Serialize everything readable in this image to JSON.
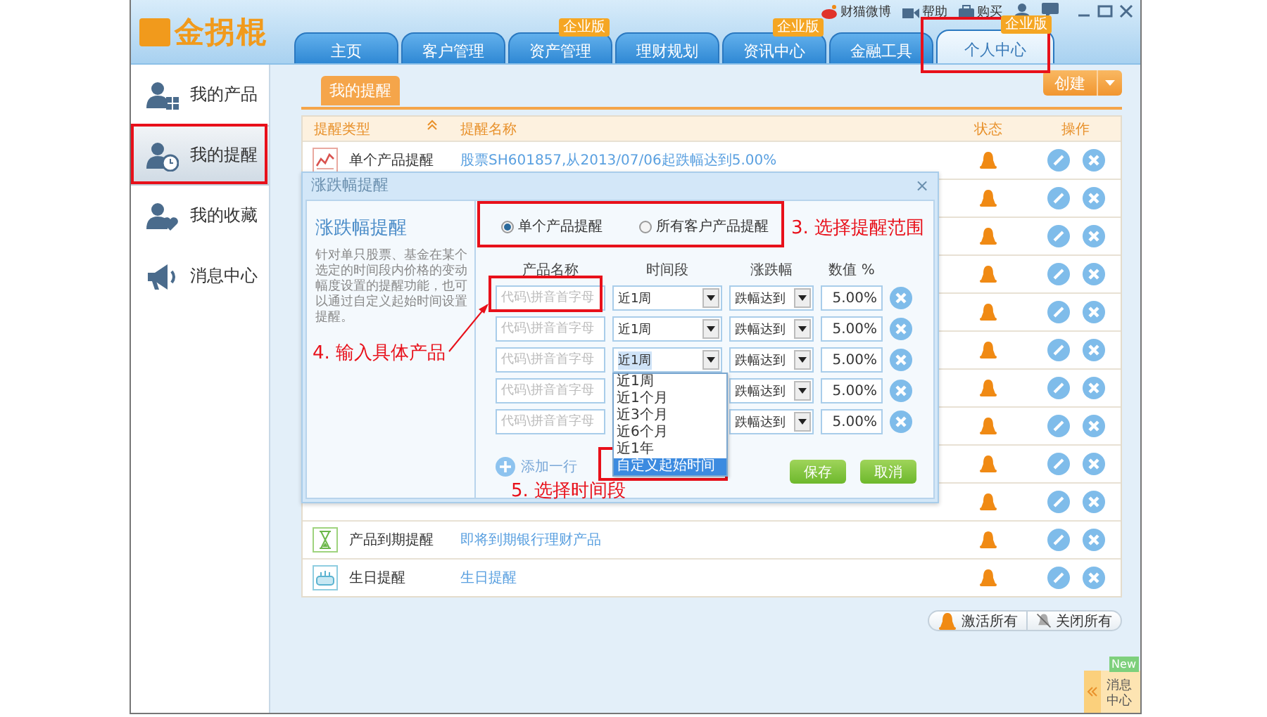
{
  "header": {
    "logo": "金拐棍",
    "top_links": [
      {
        "kind": "weibo",
        "label": "财猫微博"
      },
      {
        "kind": "video",
        "label": "帮助"
      },
      {
        "kind": "bag",
        "label": "购买"
      }
    ]
  },
  "tabs": [
    {
      "label": "主页",
      "selected": false
    },
    {
      "label": "客户管理",
      "selected": false
    },
    {
      "label": "资产管理",
      "badge": "企业版",
      "selected": false
    },
    {
      "label": "理财规划",
      "selected": false
    },
    {
      "label": "资讯中心",
      "badge": "企业版",
      "selected": false
    },
    {
      "label": "金融工具",
      "selected": false
    },
    {
      "label": "个人中心",
      "badge": "企业版",
      "selected": true
    }
  ],
  "sidebar": {
    "items": [
      {
        "kind": "products",
        "label": "我的产品",
        "selected": false
      },
      {
        "kind": "reminders",
        "label": "我的提醒",
        "selected": true
      },
      {
        "kind": "favorites",
        "label": "我的收藏",
        "selected": false
      },
      {
        "kind": "messages",
        "label": "消息中心",
        "selected": false
      }
    ]
  },
  "subtab": "我的提醒",
  "create_button": "创建",
  "table": {
    "columns": [
      "提醒类型",
      "提醒名称",
      "状态",
      "操作"
    ],
    "rows": [
      {
        "kind": "price",
        "type": "单个产品提醒",
        "name": "股票SH601857,从2013/07/06起跌幅达到5.00%"
      },
      {
        "kind": "covered"
      },
      {
        "kind": "covered"
      },
      {
        "kind": "covered"
      },
      {
        "kind": "covered"
      },
      {
        "kind": "covered"
      },
      {
        "kind": "covered"
      },
      {
        "kind": "covered"
      },
      {
        "kind": "covered"
      },
      {
        "kind": "covered"
      },
      {
        "kind": "expiry",
        "type": "产品到期提醒",
        "name": "即将到期银行理财产品"
      },
      {
        "kind": "birthday",
        "type": "生日提醒",
        "name": "生日提醒"
      }
    ]
  },
  "dialog": {
    "title": "涨跌幅提醒",
    "close": "×",
    "heading": "涨跌幅提醒",
    "description": "针对单只股票、基金在某个选定的时间段内价格的变动幅度设置的提醒功能，也可以通过自定义起始时间设置提醒。",
    "scope": [
      {
        "label": "单个产品提醒",
        "selected": true
      },
      {
        "label": "所有客户产品提醒",
        "selected": false
      }
    ],
    "columns": [
      "产品名称",
      "时间段",
      "涨跌幅",
      "数值 %"
    ],
    "rows": [
      {
        "placeholder": "代码\\拼音首字母",
        "period": "近1周",
        "direction": "跌幅达到",
        "value": "5.00%",
        "open": false
      },
      {
        "placeholder": "代码\\拼音首字母",
        "period": "近1周",
        "direction": "跌幅达到",
        "value": "5.00%",
        "open": false
      },
      {
        "placeholder": "代码\\拼音首字母",
        "period": "近1周",
        "direction": "跌幅达到",
        "value": "5.00%",
        "open": true
      },
      {
        "placeholder": "代码\\拼音首字母",
        "direction": "跌幅达到",
        "value": "5.00%"
      },
      {
        "placeholder": "代码\\拼音首字母",
        "direction": "跌幅达到",
        "value": "5.00%"
      }
    ],
    "period_options": [
      {
        "label": "近1周",
        "selected": false
      },
      {
        "label": "近1个月",
        "selected": false
      },
      {
        "label": "近3个月",
        "selected": false
      },
      {
        "label": "近6个月",
        "selected": false
      },
      {
        "label": "近1年",
        "selected": false
      },
      {
        "label": "自定义起始时间",
        "selected": true
      }
    ],
    "add_row": "添加一行",
    "save": "保存",
    "cancel": "取消"
  },
  "footer_buttons": [
    "激活所有",
    "关闭所有"
  ],
  "message_center": {
    "label": "消息中心",
    "badge": "New"
  },
  "annotations": [
    "3. 选择提醒范围",
    "4. 输入具体产品",
    "5. 选择时间段"
  ]
}
